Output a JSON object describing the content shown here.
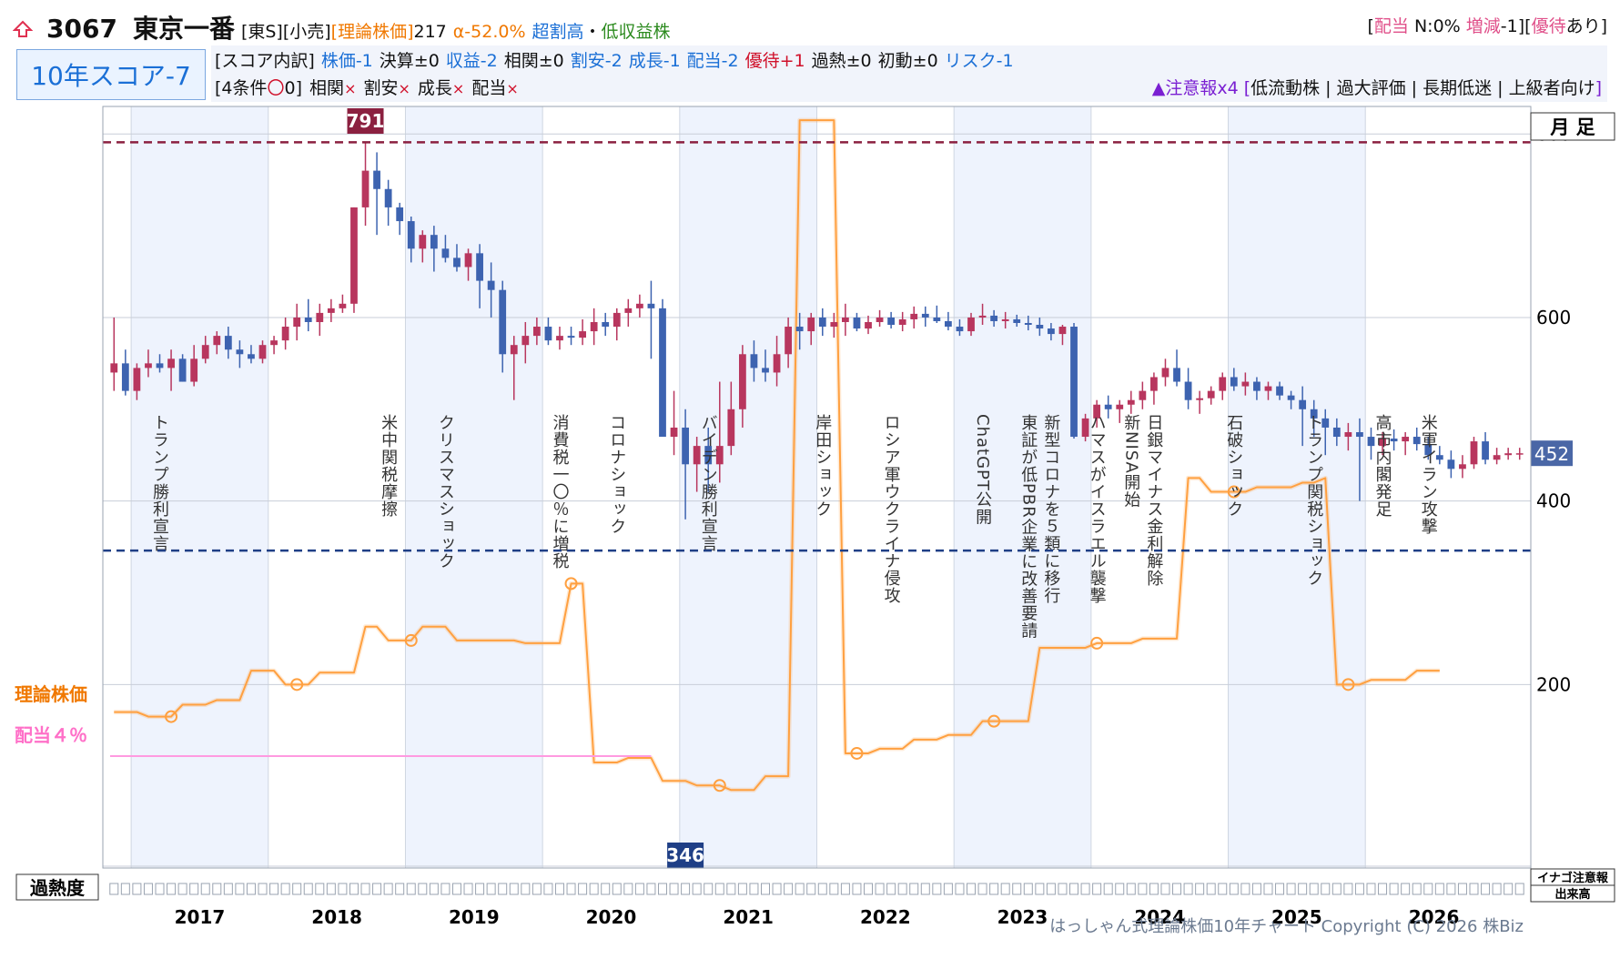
{
  "header": {
    "arrow_icon": "up-arrow-outline-icon",
    "code": "3067",
    "name": "東京一番",
    "market": "[東S][小売]",
    "theory_label": "[理論株価]",
    "theory_value": "217",
    "alpha": "α-52.0%",
    "rating": "超割高",
    "dot": "・",
    "type": "低収益株",
    "badges": {
      "open1": "[",
      "div_label": "配当",
      "div_value": " N:0% ",
      "chg_label": "増減",
      "chg_value": "-1][",
      "yutai_label": "優待",
      "yutai_value": "あり]"
    }
  },
  "score": {
    "label": "10年スコア-7"
  },
  "breakdown": {
    "prefix": "[スコア内訳]",
    "items": [
      {
        "text": "株価-1",
        "color": "#1a6fd6"
      },
      {
        "text": "決算±0",
        "color": "#111111"
      },
      {
        "text": "収益-2",
        "color": "#1a6fd6"
      },
      {
        "text": "相関±0",
        "color": "#111111"
      },
      {
        "text": "割安-2",
        "color": "#1a6fd6"
      },
      {
        "text": "成長-1",
        "color": "#1a6fd6"
      },
      {
        "text": "配当-2",
        "color": "#1a6fd6"
      },
      {
        "text": "優待+1",
        "color": "#d0102a"
      },
      {
        "text": "過熱±0",
        "color": "#111111"
      },
      {
        "text": "初動±0",
        "color": "#111111"
      },
      {
        "text": "リスク-1",
        "color": "#1a6fd6"
      }
    ]
  },
  "conditions": {
    "prefix": "[4条件",
    "circle": "〇",
    "count": "0]",
    "items": [
      "相関",
      "割安",
      "成長",
      "配当"
    ],
    "mark": "×"
  },
  "cautions": {
    "label": "▲注意報x4",
    "open": " [",
    "text": "低流動株 | 過大評価 | 長期低迷 | 上級者向け",
    "close": "]"
  },
  "chart_labels": {
    "period": "月 足",
    "theory_line_label": "理論株価",
    "div_line_label": "配当４％",
    "heat_label": "過熱度",
    "legend_caution": "イナゴ注意報",
    "legend_volume": "出来高",
    "copyright": "はっしゃん式理論株価10年チャート Copyright (C) 2026 株Biz"
  },
  "chart_data": {
    "type": "candlestick",
    "interval": "monthly",
    "ylim": [
      0,
      830
    ],
    "yticks": [
      200,
      400,
      600,
      800
    ],
    "xticks": [
      "2017",
      "2018",
      "2019",
      "2020",
      "2021",
      "2022",
      "2023",
      "2024",
      "2025",
      "2026"
    ],
    "last_price": 452,
    "high_marker": 791,
    "low_marker": 346,
    "colors": {
      "up": "#b8365e",
      "down": "#3d63b0",
      "theory": "#ffa040",
      "dividend": "#ff9ae0",
      "high_line": "#8b2040",
      "low_line": "#1f3f86",
      "band": "#eef3fd"
    },
    "candles_ohlc": [
      [
        540,
        600,
        520,
        550
      ],
      [
        550,
        565,
        515,
        520
      ],
      [
        520,
        550,
        510,
        545
      ],
      [
        545,
        565,
        535,
        550
      ],
      [
        550,
        560,
        540,
        545
      ],
      [
        545,
        565,
        520,
        555
      ],
      [
        555,
        560,
        530,
        530
      ],
      [
        530,
        570,
        525,
        555
      ],
      [
        555,
        580,
        550,
        570
      ],
      [
        570,
        585,
        560,
        580
      ],
      [
        580,
        590,
        555,
        565
      ],
      [
        565,
        575,
        545,
        560
      ],
      [
        560,
        570,
        550,
        555
      ],
      [
        555,
        575,
        550,
        570
      ],
      [
        570,
        580,
        560,
        575
      ],
      [
        575,
        600,
        565,
        590
      ],
      [
        590,
        615,
        575,
        600
      ],
      [
        600,
        620,
        585,
        595
      ],
      [
        595,
        615,
        580,
        605
      ],
      [
        605,
        620,
        595,
        610
      ],
      [
        610,
        625,
        605,
        615
      ],
      [
        615,
        720,
        605,
        720
      ],
      [
        720,
        790,
        700,
        760
      ],
      [
        760,
        780,
        690,
        740
      ],
      [
        740,
        750,
        700,
        720
      ],
      [
        720,
        725,
        690,
        705
      ],
      [
        705,
        710,
        660,
        675
      ],
      [
        675,
        695,
        660,
        690
      ],
      [
        690,
        700,
        650,
        675
      ],
      [
        675,
        690,
        660,
        665
      ],
      [
        665,
        680,
        650,
        655
      ],
      [
        655,
        675,
        640,
        670
      ],
      [
        670,
        680,
        610,
        640
      ],
      [
        640,
        660,
        600,
        630
      ],
      [
        630,
        640,
        540,
        560
      ],
      [
        560,
        580,
        510,
        570
      ],
      [
        570,
        595,
        550,
        580
      ],
      [
        580,
        600,
        570,
        590
      ],
      [
        590,
        600,
        570,
        575
      ],
      [
        575,
        590,
        565,
        580
      ],
      [
        580,
        590,
        570,
        578
      ],
      [
        578,
        598,
        570,
        585
      ],
      [
        585,
        610,
        570,
        595
      ],
      [
        595,
        605,
        580,
        590
      ],
      [
        590,
        610,
        575,
        605
      ],
      [
        605,
        620,
        590,
        610
      ],
      [
        610,
        625,
        600,
        615
      ],
      [
        615,
        640,
        555,
        610
      ],
      [
        610,
        620,
        560,
        470
      ],
      [
        470,
        520,
        450,
        480
      ],
      [
        480,
        500,
        380,
        440
      ],
      [
        440,
        470,
        410,
        460
      ],
      [
        460,
        480,
        410,
        440
      ],
      [
        440,
        530,
        420,
        460
      ],
      [
        460,
        530,
        450,
        500
      ],
      [
        500,
        570,
        480,
        560
      ],
      [
        560,
        575,
        530,
        545
      ],
      [
        545,
        565,
        530,
        540
      ],
      [
        540,
        580,
        525,
        560
      ],
      [
        560,
        600,
        545,
        590
      ],
      [
        590,
        605,
        565,
        585
      ],
      [
        585,
        605,
        570,
        600
      ],
      [
        600,
        610,
        580,
        590
      ],
      [
        590,
        605,
        578,
        595
      ],
      [
        595,
        615,
        580,
        600
      ],
      [
        600,
        605,
        585,
        588
      ],
      [
        588,
        602,
        582,
        595
      ],
      [
        595,
        608,
        590,
        600
      ],
      [
        600,
        606,
        588,
        592
      ],
      [
        592,
        606,
        585,
        598
      ],
      [
        598,
        612,
        588,
        604
      ],
      [
        604,
        612,
        590,
        600
      ],
      [
        600,
        613,
        594,
        596
      ],
      [
        596,
        606,
        586,
        590
      ],
      [
        590,
        598,
        580,
        585
      ],
      [
        585,
        605,
        580,
        600
      ],
      [
        600,
        615,
        592,
        602
      ],
      [
        602,
        608,
        590,
        596
      ],
      [
        596,
        606,
        588,
        598
      ],
      [
        598,
        603,
        590,
        594
      ],
      [
        594,
        602,
        586,
        592
      ],
      [
        592,
        600,
        580,
        588
      ],
      [
        588,
        594,
        575,
        582
      ],
      [
        582,
        592,
        570,
        590
      ],
      [
        590,
        594,
        468,
        470
      ],
      [
        470,
        495,
        465,
        490
      ],
      [
        490,
        510,
        480,
        505
      ],
      [
        505,
        515,
        490,
        500
      ],
      [
        500,
        510,
        485,
        505
      ],
      [
        505,
        520,
        495,
        510
      ],
      [
        510,
        530,
        500,
        520
      ],
      [
        520,
        540,
        505,
        535
      ],
      [
        535,
        555,
        525,
        545
      ],
      [
        545,
        565,
        525,
        530
      ],
      [
        530,
        545,
        500,
        510
      ],
      [
        510,
        520,
        495,
        512
      ],
      [
        512,
        525,
        505,
        520
      ],
      [
        520,
        540,
        510,
        535
      ],
      [
        535,
        545,
        520,
        525
      ],
      [
        525,
        540,
        515,
        530
      ],
      [
        530,
        535,
        510,
        520
      ],
      [
        520,
        530,
        510,
        525
      ],
      [
        525,
        530,
        510,
        515
      ],
      [
        515,
        520,
        500,
        510
      ],
      [
        510,
        525,
        460,
        500
      ],
      [
        500,
        510,
        470,
        490
      ],
      [
        490,
        500,
        450,
        480
      ],
      [
        480,
        490,
        460,
        470
      ],
      [
        470,
        485,
        455,
        475
      ],
      [
        475,
        490,
        400,
        470
      ],
      [
        470,
        480,
        445,
        460
      ],
      [
        460,
        475,
        450,
        468
      ],
      [
        468,
        478,
        455,
        465
      ],
      [
        465,
        475,
        450,
        470
      ],
      [
        470,
        480,
        455,
        462
      ],
      [
        462,
        470,
        445,
        450
      ],
      [
        450,
        460,
        440,
        445
      ],
      [
        445,
        455,
        425,
        435
      ],
      [
        435,
        450,
        425,
        440
      ],
      [
        440,
        470,
        435,
        465
      ],
      [
        465,
        475,
        440,
        445
      ],
      [
        445,
        458,
        440,
        450
      ],
      [
        450,
        458,
        445,
        452
      ],
      [
        452,
        458,
        445,
        452
      ]
    ],
    "theory_price": [
      170,
      170,
      170,
      165,
      165,
      165,
      178,
      178,
      178,
      183,
      183,
      183,
      215,
      215,
      215,
      200,
      200,
      200,
      213,
      213,
      213,
      213,
      263,
      263,
      248,
      248,
      248,
      263,
      263,
      263,
      248,
      248,
      248,
      248,
      248,
      248,
      245,
      245,
      245,
      245,
      310,
      310,
      115,
      115,
      115,
      120,
      120,
      120,
      95,
      95,
      95,
      90,
      90,
      90,
      85,
      85,
      85,
      100,
      100,
      100,
      815,
      815,
      815,
      815,
      125,
      125,
      125,
      130,
      130,
      130,
      140,
      140,
      140,
      145,
      145,
      145,
      160,
      160,
      160,
      160,
      160,
      240,
      240,
      240,
      240,
      240,
      245,
      245,
      245,
      245,
      250,
      250,
      250,
      250,
      425,
      425,
      410,
      410,
      410,
      410,
      415,
      415,
      415,
      415,
      420,
      420,
      425,
      200,
      200,
      200,
      205,
      205,
      205,
      205,
      215,
      215,
      215
    ],
    "theory_markers": [
      5,
      16,
      26,
      40,
      53,
      65,
      77,
      86,
      98,
      108
    ],
    "dividend_4pct": 122,
    "events": [
      {
        "text": "トランプ勝利宣言",
        "i": 4
      },
      {
        "text": "米中関税摩擦",
        "i": 24
      },
      {
        "text": "クリスマスショック",
        "i": 29
      },
      {
        "text": "消費税一〇％に増税",
        "i": 39
      },
      {
        "text": "コロナショック",
        "i": 44
      },
      {
        "text": "バイデン勝利宣言",
        "i": 52
      },
      {
        "text": "岸田ショック",
        "i": 62
      },
      {
        "text": "ロシア軍ウクライナ侵攻",
        "i": 68
      },
      {
        "text": "ChatGPT公開",
        "i": 76
      },
      {
        "text": "東証が低PBR企業に改善要請",
        "i": 80
      },
      {
        "text": "新型コロナを５類に移行",
        "i": 82
      },
      {
        "text": "ハマスがイスラエル襲撃",
        "i": 86
      },
      {
        "text": "新NISA開始",
        "i": 89
      },
      {
        "text": "日銀マイナス金利解除",
        "i": 91
      },
      {
        "text": "石破ショック",
        "i": 98
      },
      {
        "text": "トランプ関税ショック",
        "i": 105
      },
      {
        "text": "高市内閣発足",
        "i": 111
      },
      {
        "text": "米軍イラン攻撃",
        "i": 115
      }
    ]
  }
}
